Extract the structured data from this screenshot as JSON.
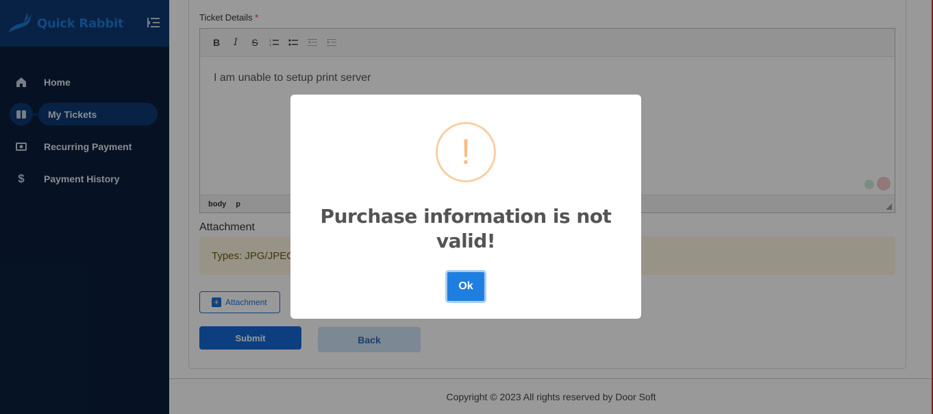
{
  "brand": {
    "name": "Quick Rabbit",
    "color": "#1f7ad6"
  },
  "sidebar": {
    "items": [
      {
        "label": "Home",
        "icon": "home-icon"
      },
      {
        "label": "My Tickets",
        "icon": "ticket-icon",
        "active": true
      },
      {
        "label": "Recurring Payment",
        "icon": "money-icon"
      },
      {
        "label": "Payment History",
        "icon": "dollar-icon"
      }
    ]
  },
  "form": {
    "ticket_details_label": "Ticket Details",
    "required_mark": "*",
    "editor": {
      "toolbar": [
        "B",
        "I",
        "S",
        "ordered-list",
        "unordered-list",
        "outdent",
        "indent"
      ],
      "content": "I am unable to setup print server",
      "status_path": [
        "body",
        "p"
      ]
    },
    "attachment_label": "Attachment",
    "types_text": "Types: JPG/JPEG",
    "attachment_button": "Attachment",
    "submit_label": "Submit",
    "back_label": "Back"
  },
  "footer": {
    "text": "Copyright © 2023 All rights reserved by Door Soft"
  },
  "modal": {
    "icon": "warning-icon",
    "title": "Purchase information is not valid!",
    "ok_label": "Ok",
    "accent": "#1e7fe0",
    "warning_color": "#f8bb86"
  }
}
